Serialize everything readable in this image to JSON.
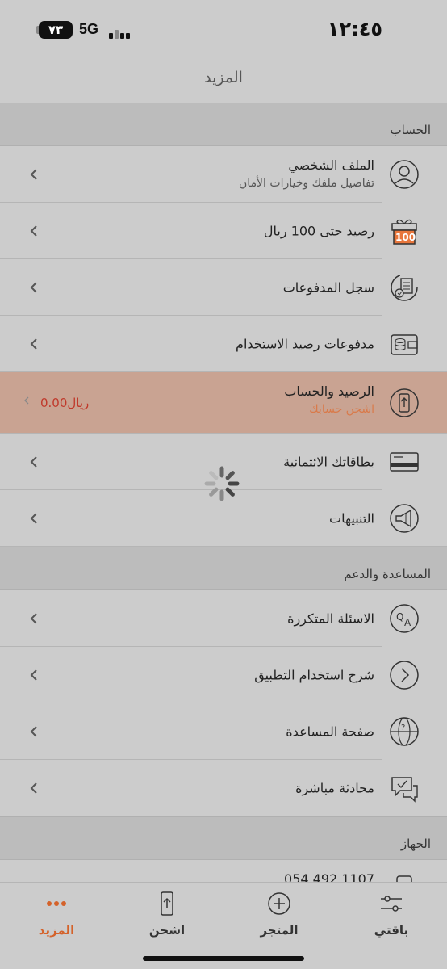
{
  "status": {
    "battery": "٧٣",
    "network": "5G",
    "time": "١٢:٤٥"
  },
  "header": {
    "title": "المزيد"
  },
  "sections": {
    "account": {
      "title": "الحساب",
      "profile": {
        "label": "الملف الشخصي",
        "sub": "تفاصيل ملفك وخيارات الأمان",
        "icon": "user-icon"
      },
      "credit_100": {
        "label": "رصيد حتى 100 ريال",
        "icon": "gift-100-icon",
        "badge": "100"
      },
      "payments_log": {
        "label": "سجل المدفوعات",
        "icon": "receipt-icon"
      },
      "usage_payments": {
        "label": "مدفوعات رصيد الاستخدام",
        "icon": "wallet-icon"
      },
      "balance": {
        "label": "الرصيد والحساب",
        "sub": "اشحن حسابك",
        "amount": "0.00ريال",
        "icon": "phone-topup-icon"
      },
      "cards": {
        "label": "بطاقاتك الائتمانية",
        "icon": "credit-card-icon"
      },
      "notifications": {
        "label": "التنبيهات",
        "icon": "megaphone-icon"
      }
    },
    "support": {
      "title": "المساعدة والدعم",
      "faq": {
        "label": "الاسئلة المتكررة",
        "icon": "qa-icon"
      },
      "tutorial": {
        "label": "شرح استخدام التطبيق",
        "icon": "arrow-circle-icon"
      },
      "help_page": {
        "label": "صفحة المساعدة",
        "icon": "globe-icon"
      },
      "live_chat": {
        "label": "محادثة مباشرة",
        "icon": "chat-icon"
      }
    },
    "device": {
      "title": "الجهاز",
      "number": {
        "label": "054 492 1107",
        "icon": "phone-icon"
      }
    }
  },
  "tabs": [
    {
      "label": "باقتي",
      "icon": "sliders-icon"
    },
    {
      "label": "المتجر",
      "icon": "plus-circle-icon"
    },
    {
      "label": "اشحن",
      "icon": "phone-topup-icon"
    },
    {
      "label": "المزيد",
      "icon": "more-dots-icon",
      "active": true
    }
  ],
  "colors": {
    "accent": "#d4622a",
    "highlight": "#c9a392",
    "amount": "#c0392b"
  }
}
